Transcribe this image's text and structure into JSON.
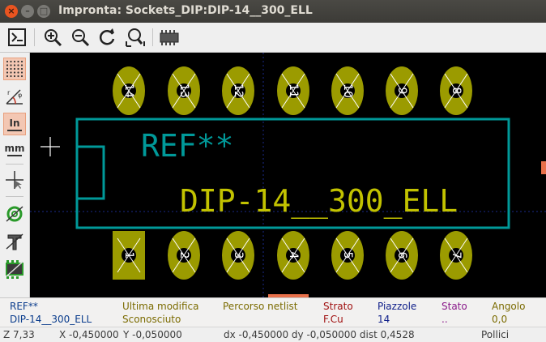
{
  "window": {
    "title": "Impronta: Sockets_DIP:DIP-14__300_ELL",
    "close_glyph": "×",
    "minimize_glyph": "–",
    "maximize_glyph": "□"
  },
  "toolbar": {
    "items": [
      "board-icon",
      "zoom-in-icon",
      "zoom-out-icon",
      "redraw-icon",
      "zoom-fit-icon",
      "footprint-icon"
    ]
  },
  "left_toolbar": {
    "units_inch": "In",
    "units_mm": "mm",
    "items": [
      "grid-icon",
      "polar-coords-icon",
      "units-inch-button",
      "units-mm-button",
      "cursor-shape-icon",
      "pad-sketch-icon",
      "text-sketch-icon",
      "edge-sketch-icon"
    ]
  },
  "footprint": {
    "reference": "REF**",
    "value": "DIP-14__300_ELL",
    "top_pads": [
      "14",
      "13",
      "12",
      "11",
      "10",
      "9",
      "8"
    ],
    "bottom_pads": [
      "1",
      "2",
      "3",
      "4",
      "5",
      "6",
      "7"
    ],
    "colors": {
      "pad": "#9b9b00",
      "pad_label": "#ffffff",
      "silkscreen": "#009999",
      "reference_text": "#009999",
      "value_text": "#c2c200",
      "background": "#000000"
    }
  },
  "message_panel": {
    "columns": [
      {
        "label": "REF**",
        "value": "DIP-14__300_ELL",
        "label_color": "#0a3c8c",
        "value_color": "#0a3c8c"
      },
      {
        "label": "Ultima modifica",
        "value": "Sconosciuto",
        "label_color": "#7b6b00",
        "value_color": "#7b6b00"
      },
      {
        "label": "Percorso netlist",
        "value": "",
        "label_color": "#7b6b00",
        "value_color": "#7b6b00"
      },
      {
        "label": "Strato",
        "value": "F.Cu",
        "label_color": "#a01010",
        "value_color": "#a01010"
      },
      {
        "label": "Piazzole",
        "value": "14",
        "label_color": "#10208a",
        "value_color": "#10208a"
      },
      {
        "label": "Stato",
        "value": "..",
        "label_color": "#8a1a8a",
        "value_color": "#8a1a8a"
      },
      {
        "label": "Angolo",
        "value": "0,0",
        "label_color": "#7b6b00",
        "value_color": "#7b6b00"
      }
    ]
  },
  "status": {
    "zoom": "Z 7,33",
    "x": "X -0,450000",
    "y": "Y -0,050000",
    "delta": "dx -0,450000 dy -0,050000 dist 0,4528",
    "units": "Pollici"
  }
}
